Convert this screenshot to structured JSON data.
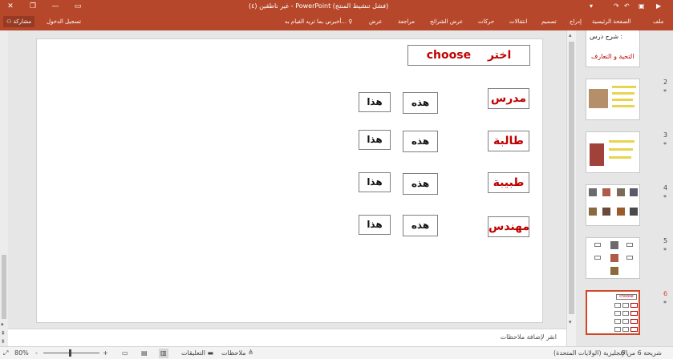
{
  "title_bar": {
    "title": "غير ناطقين (٤) - PowerPoint (فشل تنشيط المنتج)",
    "sign_in": "تسجيل الدخول",
    "share": "مشاركة",
    "minimize": "—",
    "restore": "❐",
    "close": "✕"
  },
  "ribbon": {
    "tabs": [
      "ملف",
      "الصفحة الرئيسية",
      "إدراج",
      "تصميم",
      "انتقالات",
      "حركات",
      "عرض الشرائح",
      "مراجعة",
      "عرض"
    ],
    "tell_me": "أخبرني بما تريد القيام به..."
  },
  "slide": {
    "header_arabic": "اختر",
    "header_english": "choose",
    "rows": [
      {
        "word": "مدرس",
        "opt1": "هذه",
        "opt2": "هذا"
      },
      {
        "word": "طالبة",
        "opt1": "هذه",
        "opt2": "هذا"
      },
      {
        "word": "طبيبة",
        "opt1": "هذه",
        "opt2": "هذا"
      },
      {
        "word": "مهندس",
        "opt1": "هذه",
        "opt2": "هذا"
      }
    ]
  },
  "thumbnails": {
    "t1_line1": "شرح درس :",
    "t1_line2": "التحية و التعارف",
    "numbers": [
      "2",
      "3",
      "4",
      "5",
      "6"
    ],
    "star": "*",
    "t6_header": "choose"
  },
  "notes_placeholder": "انقر لإضافة ملاحظات",
  "status_bar": {
    "slide_info": "شريحة 6 من 6",
    "language": "الإنجليزية (الولايات المتحدة)",
    "notes": "ملاحظات",
    "comments": "التعليقات",
    "zoom": "80%",
    "minus": "-",
    "plus": "+"
  },
  "colors": {
    "accent": "#b7472a",
    "red_text": "#c00000",
    "selected_border": "#d24726"
  }
}
